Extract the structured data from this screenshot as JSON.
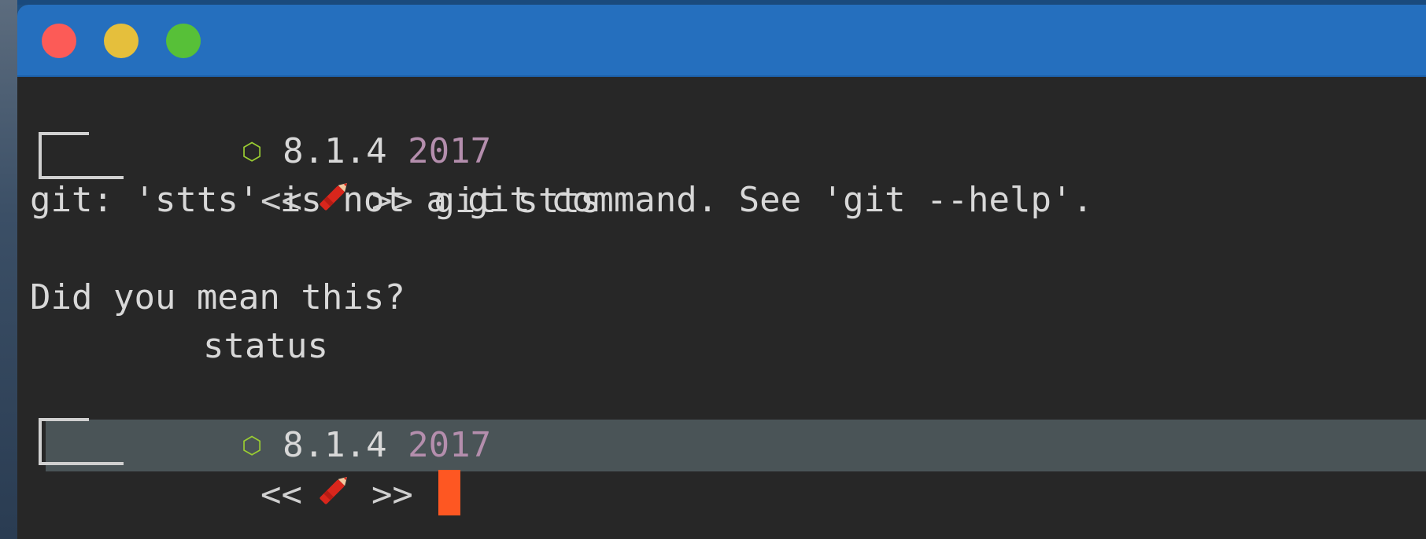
{
  "window": {
    "buttons": [
      "close",
      "minimize",
      "zoom"
    ]
  },
  "terminal": {
    "prompt1": {
      "icon": "hexagon-icon",
      "version": "8.1.4",
      "year": "2017",
      "open_brace": "<<",
      "close_brace": ">>",
      "command": "git stts"
    },
    "output": {
      "line1": "git: 'stts' is not a git command. See 'git --help'.",
      "line2": "Did you mean this?",
      "suggestion": "status"
    },
    "prompt2": {
      "icon": "hexagon-icon",
      "version": "8.1.4",
      "year": "2017",
      "open_brace": "<<",
      "close_brace": ">>",
      "command": ""
    }
  },
  "colors": {
    "titlebar": "#256fbe",
    "background": "#272727",
    "text": "#d8d8d8",
    "year": "#b48ead",
    "hexagon": "#9acd32",
    "cursor": "#fe5722",
    "current_line": "#4a5457"
  }
}
